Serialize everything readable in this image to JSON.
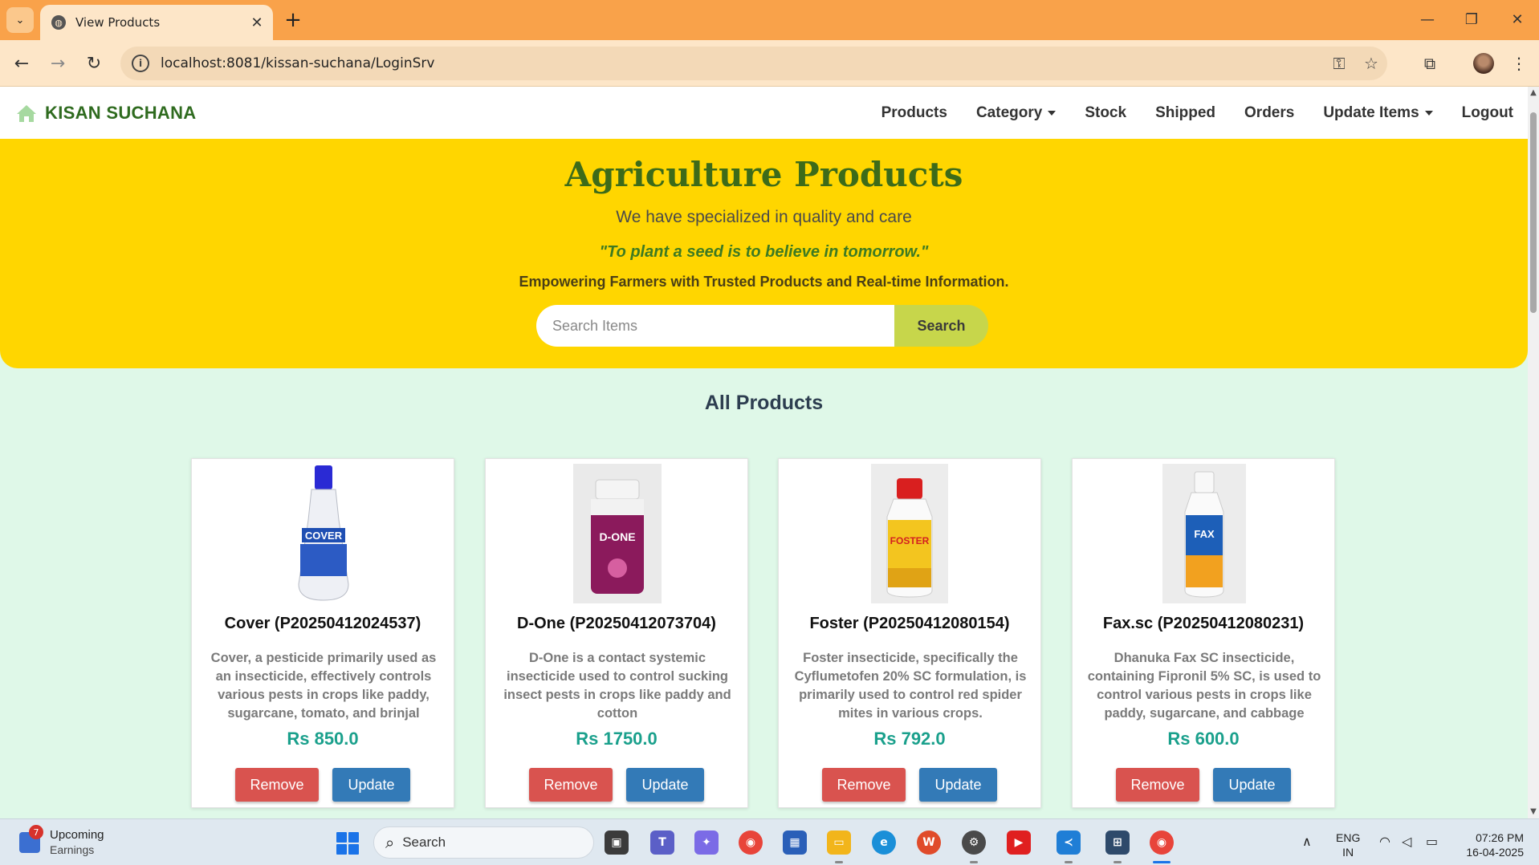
{
  "browser": {
    "tab_title": "View Products",
    "url": "localhost:8081/kissan-suchana/LoginSrv",
    "new_tab_label": "+",
    "close_tab_label": "✕"
  },
  "site": {
    "brand": "KISAN SUCHANA",
    "nav": {
      "products": "Products",
      "category": "Category",
      "stock": "Stock",
      "shipped": "Shipped",
      "orders": "Orders",
      "update_items": "Update Items",
      "logout": "Logout"
    }
  },
  "hero": {
    "title": "Agriculture Products",
    "subtitle": "We have specialized in quality and care",
    "quote": "\"To plant a seed is to believe in tomorrow.\"",
    "tagline": "Empowering Farmers with Trusted Products and Real-time Information.",
    "search_placeholder": "Search Items",
    "search_button": "Search"
  },
  "section_title": "All Products",
  "products": [
    {
      "name": "Cover (P20250412024537)",
      "description": "Cover, a pesticide primarily used as an insecticide, effectively controls various pests in crops like paddy, sugarcane, tomato, and brinjal",
      "price": "Rs 850.0",
      "image_label": "COVER",
      "remove_label": "Remove",
      "update_label": "Update"
    },
    {
      "name": "D-One (P20250412073704)",
      "description": "D-One is a contact systemic insecticide used to control sucking insect pests in crops like paddy and cotton",
      "price": "Rs 1750.0",
      "image_label": "D-ONE",
      "remove_label": "Remove",
      "update_label": "Update"
    },
    {
      "name": "Foster (P20250412080154)",
      "description": "Foster insecticide, specifically the Cyflumetofen 20% SC formulation, is primarily used to control red spider mites in various crops.",
      "price": "Rs 792.0",
      "image_label": "FOSTER",
      "remove_label": "Remove",
      "update_label": "Update"
    },
    {
      "name": "Fax.sc (P20250412080231)",
      "description": "Dhanuka Fax SC insecticide, containing Fipronil 5% SC, is used to control various pests in crops like paddy, sugarcane, and cabbage",
      "price": "Rs 600.0",
      "image_label": "FAX",
      "remove_label": "Remove",
      "update_label": "Update"
    }
  ],
  "taskbar": {
    "notification_count": "7",
    "widget_title": "Upcoming",
    "widget_sub": "Earnings",
    "search_label": "Search",
    "lang_line1": "ENG",
    "lang_line2": "IN",
    "time": "07:26 PM",
    "date": "16-04-2025"
  },
  "colors": {
    "tabstrip": "#f9a24a",
    "hero": "#ffd600",
    "brand": "#2f6b1f",
    "price": "#1aa08c",
    "remove": "#d9534f",
    "update": "#337ab7",
    "page_bg": "#dff8e8"
  }
}
